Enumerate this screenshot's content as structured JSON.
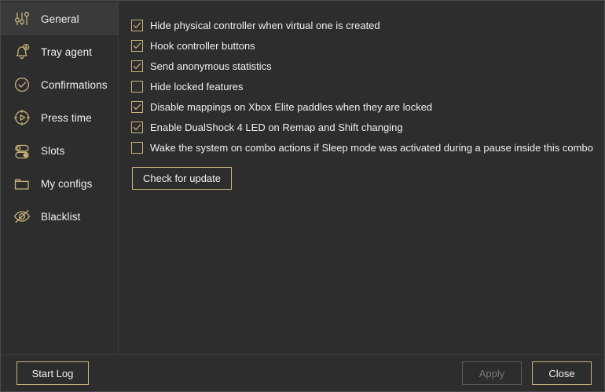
{
  "colors": {
    "accent": "#c9b37a",
    "background": "#2d2d2d",
    "selected_row": "#3a3a3a",
    "text": "#efefef",
    "disabled_text": "#787878",
    "divider": "#3b3b3b"
  },
  "sidebar": {
    "items": [
      {
        "label": "General",
        "icon": "sliders-icon",
        "selected": true
      },
      {
        "label": "Tray agent",
        "icon": "bell-icon",
        "selected": false
      },
      {
        "label": "Confirmations",
        "icon": "check-circle-icon",
        "selected": false
      },
      {
        "label": "Press time",
        "icon": "stopwatch-icon",
        "selected": false
      },
      {
        "label": "Slots",
        "icon": "toggles-icon",
        "selected": false
      },
      {
        "label": "My configs",
        "icon": "folder-icon",
        "selected": false
      },
      {
        "label": "Blacklist",
        "icon": "eye-off-icon",
        "selected": false
      }
    ]
  },
  "main": {
    "options": [
      {
        "label": "Hide physical controller when virtual one is created",
        "checked": true
      },
      {
        "label": "Hook controller buttons",
        "checked": true
      },
      {
        "label": "Send anonymous statistics",
        "checked": true
      },
      {
        "label": "Hide locked features",
        "checked": false
      },
      {
        "label": "Disable mappings on Xbox Elite paddles when they are locked",
        "checked": true
      },
      {
        "label": "Enable DualShock 4 LED on Remap and Shift changing",
        "checked": true
      },
      {
        "label": "Wake the system on combo actions if Sleep mode was activated during a pause inside this combo",
        "checked": false
      }
    ],
    "check_update_label": "Check for update"
  },
  "footer": {
    "start_log_label": "Start Log",
    "apply_label": "Apply",
    "apply_enabled": false,
    "close_label": "Close"
  }
}
